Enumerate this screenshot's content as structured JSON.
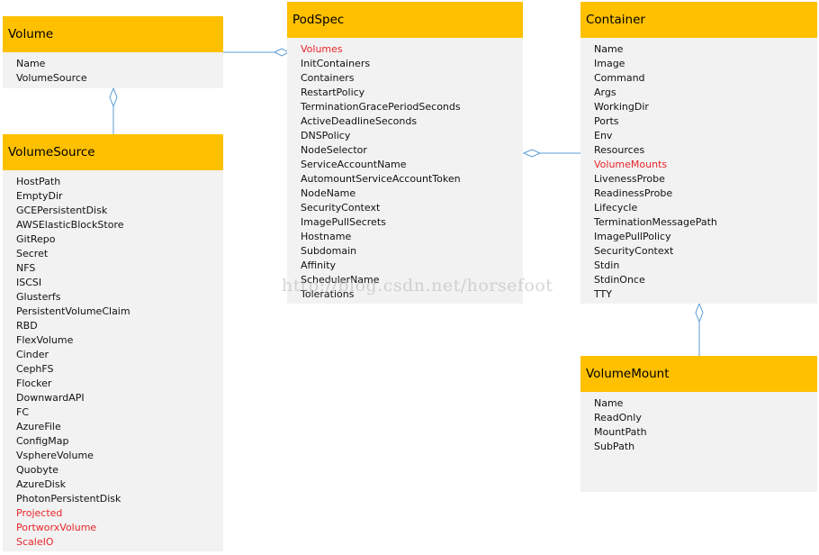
{
  "boxes": {
    "volume": {
      "title": "Volume",
      "fields": [
        {
          "name": "Name"
        },
        {
          "name": "VolumeSource"
        }
      ]
    },
    "volume_source": {
      "title": "VolumeSource",
      "fields": [
        {
          "name": "HostPath"
        },
        {
          "name": "EmptyDir"
        },
        {
          "name": "GCEPersistentDisk"
        },
        {
          "name": "AWSElasticBlockStore"
        },
        {
          "name": "GitRepo"
        },
        {
          "name": "Secret"
        },
        {
          "name": "NFS"
        },
        {
          "name": "ISCSI"
        },
        {
          "name": "Glusterfs"
        },
        {
          "name": "PersistentVolumeClaim"
        },
        {
          "name": "RBD"
        },
        {
          "name": "FlexVolume"
        },
        {
          "name": "Cinder"
        },
        {
          "name": "CephFS"
        },
        {
          "name": "Flocker"
        },
        {
          "name": "DownwardAPI"
        },
        {
          "name": "FC"
        },
        {
          "name": "AzureFile"
        },
        {
          "name": "ConfigMap"
        },
        {
          "name": "VsphereVolume"
        },
        {
          "name": "Quobyte"
        },
        {
          "name": "AzureDisk"
        },
        {
          "name": "PhotonPersistentDisk"
        },
        {
          "name": "Projected",
          "highlight": true
        },
        {
          "name": "PortworxVolume",
          "highlight": true
        },
        {
          "name": "ScaleIO",
          "highlight": true
        }
      ]
    },
    "pod_spec": {
      "title": "PodSpec",
      "fields": [
        {
          "name": "Volumes",
          "highlight": true
        },
        {
          "name": "InitContainers"
        },
        {
          "name": "Containers"
        },
        {
          "name": "RestartPolicy"
        },
        {
          "name": "TerminationGracePeriodSeconds"
        },
        {
          "name": "ActiveDeadlineSeconds"
        },
        {
          "name": "DNSPolicy"
        },
        {
          "name": "NodeSelector"
        },
        {
          "name": "ServiceAccountName"
        },
        {
          "name": "AutomountServiceAccountToken"
        },
        {
          "name": "NodeName"
        },
        {
          "name": "SecurityContext"
        },
        {
          "name": "ImagePullSecrets"
        },
        {
          "name": "Hostname"
        },
        {
          "name": "Subdomain"
        },
        {
          "name": "Affinity"
        },
        {
          "name": "SchedulerName"
        },
        {
          "name": "Tolerations"
        }
      ]
    },
    "container": {
      "title": "Container",
      "fields": [
        {
          "name": "Name"
        },
        {
          "name": "Image"
        },
        {
          "name": "Command"
        },
        {
          "name": "Args"
        },
        {
          "name": "WorkingDir"
        },
        {
          "name": "Ports"
        },
        {
          "name": "Env"
        },
        {
          "name": "Resources"
        },
        {
          "name": "VolumeMounts",
          "highlight": true
        },
        {
          "name": "LivenessProbe"
        },
        {
          "name": "ReadinessProbe"
        },
        {
          "name": "Lifecycle"
        },
        {
          "name": "TerminationMessagePath"
        },
        {
          "name": "ImagePullPolicy"
        },
        {
          "name": "SecurityContext"
        },
        {
          "name": "Stdin"
        },
        {
          "name": "StdinOnce"
        },
        {
          "name": "TTY"
        }
      ]
    },
    "volume_mount": {
      "title": "VolumeMount",
      "fields": [
        {
          "name": "Name"
        },
        {
          "name": "ReadOnly"
        },
        {
          "name": "MountPath"
        },
        {
          "name": "SubPath"
        }
      ]
    }
  },
  "watermark": "http://blog.csdn.net/horsefoot",
  "colors": {
    "header": "#ffc000",
    "body": "#f2f2f2",
    "highlight": "#e8262a",
    "connector": "#5b9bd5"
  }
}
